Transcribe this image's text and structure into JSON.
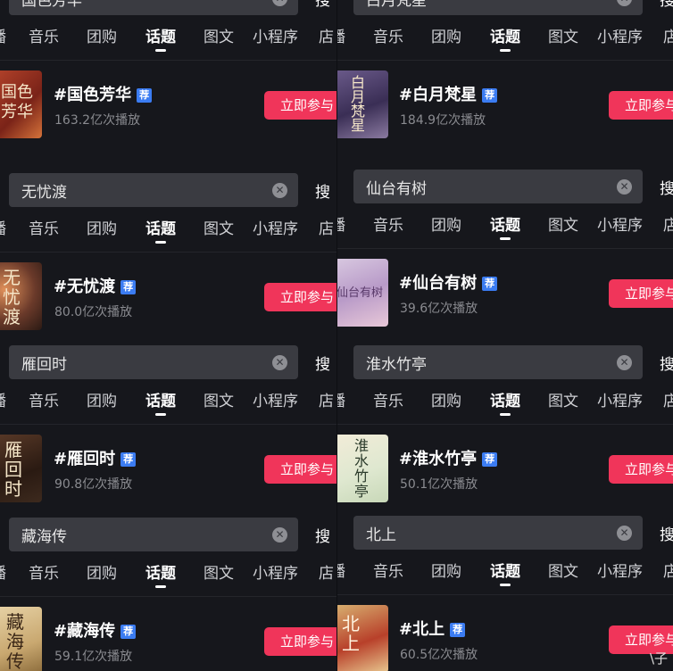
{
  "tab_labels": [
    "播",
    "音乐",
    "团购",
    "话题",
    "图文",
    "小程序",
    "店"
  ],
  "search_button_label": "搜",
  "join_label": "立即参与",
  "badge_label": "荐",
  "left": [
    {
      "query": "国色芳华",
      "topic": "#国色芳华",
      "plays": "163.2亿次播放",
      "thumb_text": "国色芳华"
    },
    {
      "query": "无忧渡",
      "topic": "#无忧渡",
      "plays": "80.0亿次播放",
      "thumb_text": "无忧渡"
    },
    {
      "query": "雁回时",
      "topic": "#雁回时",
      "plays": "90.8亿次播放",
      "thumb_text": "雁回时"
    },
    {
      "query": "藏海传",
      "topic": "#藏海传",
      "plays": "59.1亿次播放",
      "thumb_text": "藏海传"
    }
  ],
  "right": [
    {
      "query": "白月梵星",
      "topic": "#白月梵星",
      "plays": "184.9亿次播放",
      "thumb_text": "白月梵星"
    },
    {
      "query": "仙台有树",
      "topic": "#仙台有树",
      "plays": "39.6亿次播放",
      "thumb_text": "仙台有树"
    },
    {
      "query": "淮水竹亭",
      "topic": "#淮水竹亭",
      "plays": "50.1亿次播放",
      "thumb_text": "淮水竹亭"
    },
    {
      "query": "北上",
      "topic": "#北上",
      "plays": "60.5亿次播放",
      "thumb_text": "北上"
    }
  ],
  "watermark": "\\子",
  "colors": {
    "background": "#16171c",
    "join_button": "#f0355a",
    "badge": "#3b7cf2",
    "search_box": "#3a3b41"
  }
}
